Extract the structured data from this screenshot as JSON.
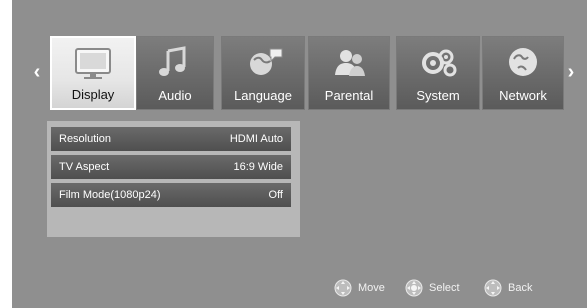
{
  "nav": {
    "left_arrow": "‹",
    "right_arrow": "›"
  },
  "tabs": [
    {
      "label": "Display",
      "icon": "display-icon",
      "selected": true
    },
    {
      "label": "Audio",
      "icon": "music-note-icon",
      "selected": false
    },
    {
      "label": "Language",
      "icon": "globe-speech-icon",
      "selected": false
    },
    {
      "label": "Parental",
      "icon": "parental-users-icon",
      "selected": false
    },
    {
      "label": "System",
      "icon": "gears-icon",
      "selected": false
    },
    {
      "label": "Network",
      "icon": "network-globe-icon",
      "selected": false
    }
  ],
  "settings": [
    {
      "name": "Resolution",
      "value": "HDMI Auto"
    },
    {
      "name": "TV Aspect",
      "value": "16:9 Wide"
    },
    {
      "name": "Film Mode(1080p24)",
      "value": "Off"
    }
  ],
  "hints": [
    {
      "label": "Move",
      "icon": "dpad-move-icon"
    },
    {
      "label": "Select",
      "icon": "dpad-select-icon"
    },
    {
      "label": "Back",
      "icon": "dpad-back-icon"
    }
  ],
  "colors": {
    "background": "#8f8f8f",
    "tab": "#6a6a6a",
    "tab_selected": "#e6e6e6",
    "panel": "#b7b7b7",
    "row": "#5a5a5a"
  }
}
